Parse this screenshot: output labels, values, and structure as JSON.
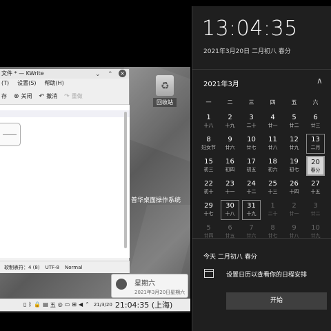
{
  "desktop": {
    "trash_label": "回收站",
    "os_name": "普华桌面操作系统"
  },
  "kwrite": {
    "title": "文件 * — KWrite",
    "menu": [
      "(T)",
      "设置(S)",
      "帮助(H)"
    ],
    "toolbar": {
      "item0": "存",
      "close": "关闭",
      "undo": "撤消",
      "redo": "重做"
    },
    "status": {
      "tab": "软制表符：4 (8)",
      "encoding": "UTF-8",
      "mode": "Normal"
    }
  },
  "taskbar": {
    "date": "21/3/20",
    "clock": "21:04:35 (上海)"
  },
  "tooltip": {
    "weekday": "星期六",
    "date": "2021年3月20日星期六"
  },
  "flyout": {
    "time": "13:04:35",
    "date": "2021年3月20日 二月初八 春分",
    "month": "2021年3月",
    "weekdays": [
      "一",
      "二",
      "三",
      "四",
      "五",
      "六"
    ],
    "agenda_title": "今天 二月初八 春分",
    "agenda_text": "设置日历以查看你的日程安排",
    "start_button": "开始"
  },
  "calendar_rows": [
    [
      {
        "n": "1",
        "l": "十八"
      },
      {
        "n": "2",
        "l": "十九"
      },
      {
        "n": "3",
        "l": "二十"
      },
      {
        "n": "4",
        "l": "廿一"
      },
      {
        "n": "5",
        "l": "廿二"
      },
      {
        "n": "6",
        "l": "廿三"
      }
    ],
    [
      {
        "n": "8",
        "l": "妇女节"
      },
      {
        "n": "9",
        "l": "廿六"
      },
      {
        "n": "10",
        "l": "廿七"
      },
      {
        "n": "11",
        "l": "廿八"
      },
      {
        "n": "12",
        "l": "廿九"
      },
      {
        "n": "13",
        "l": "二月"
      }
    ],
    [
      {
        "n": "15",
        "l": "初三"
      },
      {
        "n": "16",
        "l": "初四"
      },
      {
        "n": "17",
        "l": "初五"
      },
      {
        "n": "18",
        "l": "初六"
      },
      {
        "n": "19",
        "l": "初七"
      },
      {
        "n": "20",
        "l": "春分"
      }
    ],
    [
      {
        "n": "22",
        "l": "初十"
      },
      {
        "n": "23",
        "l": "十一"
      },
      {
        "n": "24",
        "l": "十二"
      },
      {
        "n": "25",
        "l": "十三"
      },
      {
        "n": "26",
        "l": "十四"
      },
      {
        "n": "27",
        "l": "十五"
      }
    ],
    [
      {
        "n": "29",
        "l": "十七"
      },
      {
        "n": "30",
        "l": "十八"
      },
      {
        "n": "31",
        "l": "十九"
      },
      {
        "n": "1",
        "l": "二十"
      },
      {
        "n": "2",
        "l": "廿一"
      },
      {
        "n": "3",
        "l": "廿二"
      }
    ],
    [
      {
        "n": "5",
        "l": "廿四"
      },
      {
        "n": "6",
        "l": "廿五"
      },
      {
        "n": "7",
        "l": "廿六"
      },
      {
        "n": "8",
        "l": "廿七"
      },
      {
        "n": "9",
        "l": "廿八"
      },
      {
        "n": "10",
        "l": "廿九"
      }
    ]
  ],
  "calendar_state": {
    "today": [
      2,
      5
    ],
    "highlighted": [
      [
        1,
        5
      ],
      [
        4,
        1
      ],
      [
        4,
        2
      ]
    ],
    "other_month_row4_from_col": 3,
    "other_month_rows": [
      5
    ]
  }
}
